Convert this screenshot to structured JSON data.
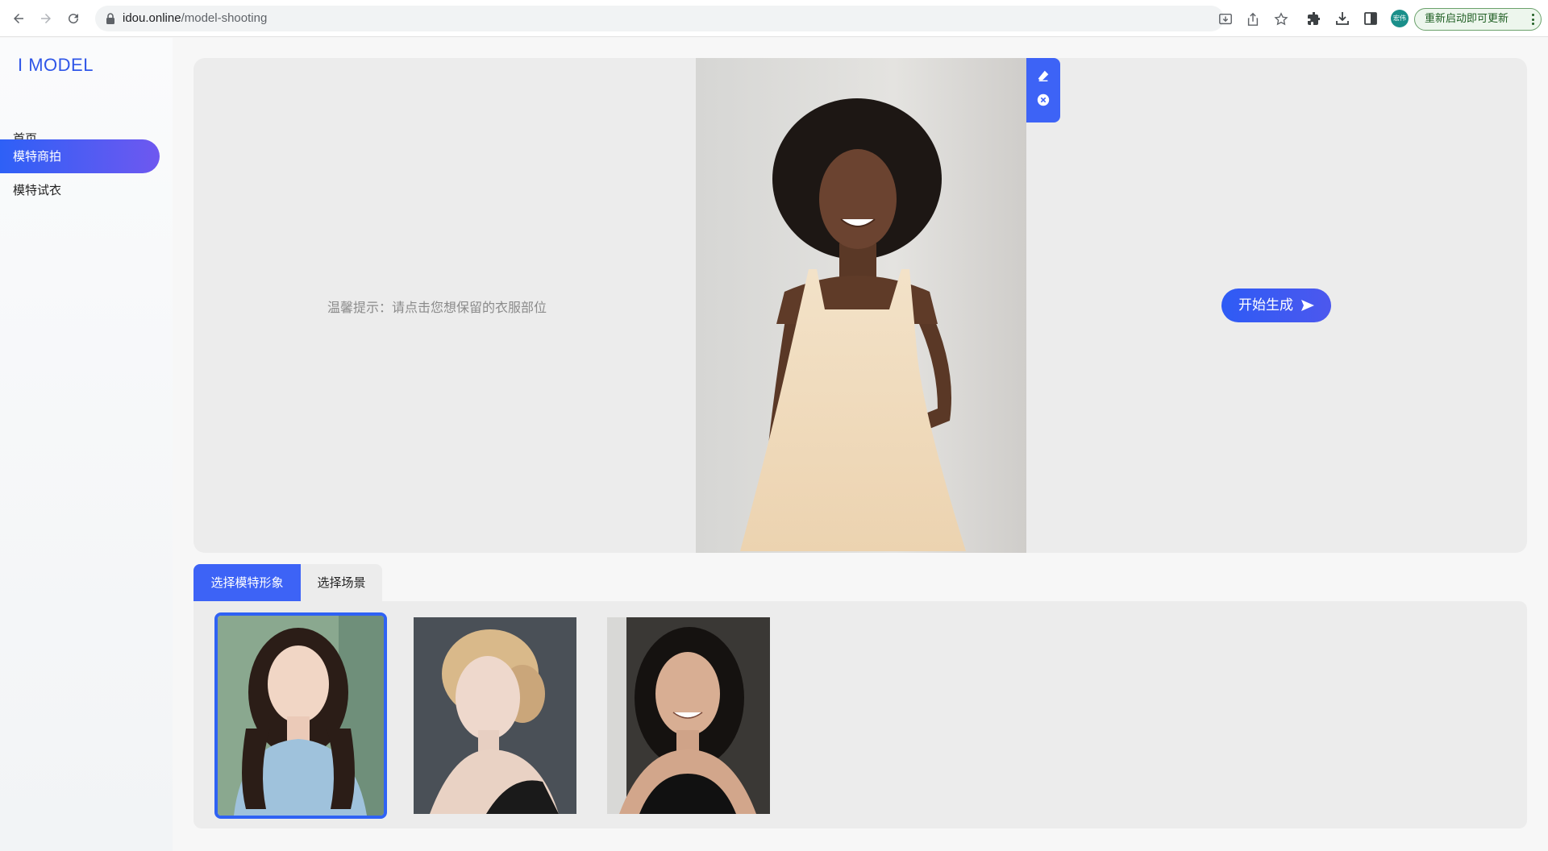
{
  "browser": {
    "url_domain": "idou.online",
    "url_path": "/model-shooting",
    "profile_initials": "宏伟",
    "update_button": "重新启动即可更新",
    "icons": [
      "back-icon",
      "forward-icon",
      "reload-icon",
      "lock-icon",
      "install-app-icon",
      "share-icon",
      "bookmark-star-icon",
      "extensions-icon",
      "download-icon",
      "side-panel-icon",
      "more-menu-icon"
    ]
  },
  "sidebar": {
    "logo": "I MODEL",
    "items": [
      {
        "label": "首页",
        "active": false
      },
      {
        "label": "模特商拍",
        "active": true
      },
      {
        "label": "模特试衣",
        "active": false
      }
    ]
  },
  "workspace": {
    "hint": "温馨提示：请点击您想保留的衣服部位",
    "tools": [
      "eraser-icon",
      "close-circle-icon"
    ],
    "start_button": "开始生成"
  },
  "tabs": [
    {
      "label": "选择模特形象",
      "active": true
    },
    {
      "label": "选择场景",
      "active": false
    }
  ],
  "gallery": {
    "models": [
      {
        "description": "model-1",
        "selected": true
      },
      {
        "description": "model-2",
        "selected": false
      },
      {
        "description": "model-3",
        "selected": false
      }
    ]
  },
  "colors": {
    "accent": "#3d63f6",
    "logo": "#2f56e8",
    "panel": "#ececec"
  }
}
